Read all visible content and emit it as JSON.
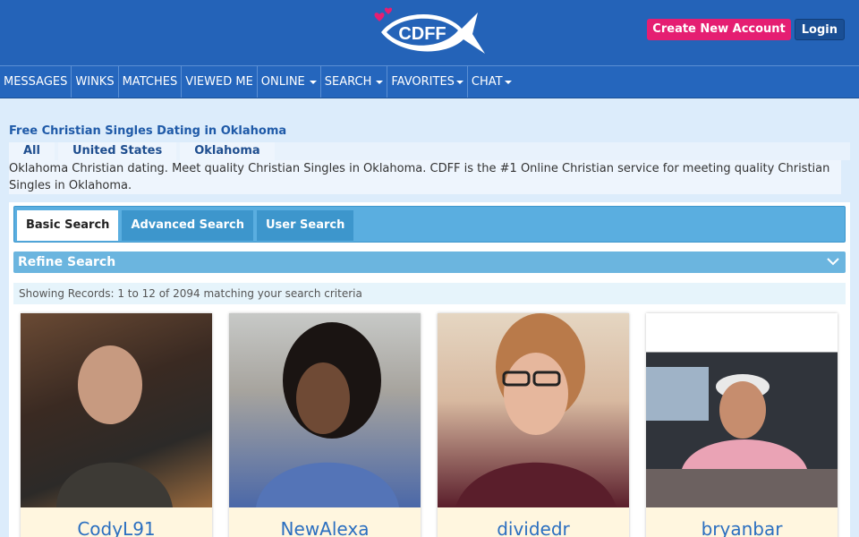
{
  "header": {
    "logo_text": "CDFF",
    "create_account_label": "Create New Account",
    "login_label": "Login"
  },
  "nav": {
    "items": [
      {
        "label": "MESSAGES",
        "dropdown": false
      },
      {
        "label": "WINKS",
        "dropdown": false
      },
      {
        "label": "MATCHES",
        "dropdown": false
      },
      {
        "label": "VIEWED ME",
        "dropdown": false
      },
      {
        "label": "ONLINE",
        "dropdown": true
      },
      {
        "label": "SEARCH",
        "dropdown": true
      },
      {
        "label": "FAVORITES",
        "dropdown": true
      },
      {
        "label": "CHAT",
        "dropdown": true
      }
    ]
  },
  "page": {
    "title": "Free Christian Singles Dating in Oklahoma",
    "breadcrumbs": [
      "All",
      "United States",
      "Oklahoma"
    ],
    "intro": "Oklahoma Christian dating. Meet quality Christian Singles in Oklahoma. CDFF is the #1 Online Christian service for meeting quality Christian Singles in Oklahoma."
  },
  "search": {
    "tabs": [
      "Basic Search",
      "Advanced Search",
      "User Search"
    ],
    "active_tab": "Basic Search",
    "refine_label": "Refine Search",
    "records_text": "Showing Records: 1 to 12 of 2094 matching your search criteria"
  },
  "results": [
    {
      "username": "CodyL91"
    },
    {
      "username": "NewAlexa"
    },
    {
      "username": "dividedr"
    },
    {
      "username": "bryanbar"
    }
  ],
  "colors": {
    "header_bg": "#2463b8",
    "create_button": "#e51e72",
    "tab_bar": "#5aaee0",
    "card_bg": "#fff6df"
  }
}
